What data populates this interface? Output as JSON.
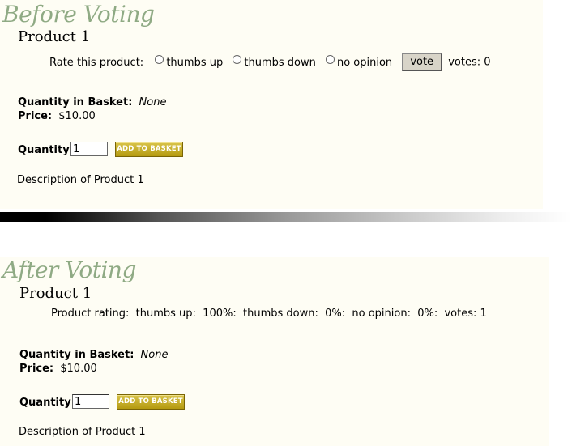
{
  "before": {
    "label": "Before Voting",
    "product_title": "Product 1",
    "rate_label": "Rate this product:",
    "options": [
      "thumbs up",
      "thumbs down",
      "no opinion"
    ],
    "vote_button": "vote",
    "votes_text": "votes: 0",
    "basket_label": "Quantity in Basket:",
    "basket_value": "None",
    "price_label": "Price:",
    "price_value": "$10.00",
    "quantity_label": "Quantity:",
    "quantity_value": "1",
    "add_button": "ADD TO BASKET",
    "description": "Description of Product 1"
  },
  "after": {
    "label": "After Voting",
    "product_title": "Product 1",
    "rating_text": "Product rating:  thumbs up:  100%:  thumbs down:  0%:  no opinion:  0%:  votes: 1",
    "basket_label": "Quantity in Basket:",
    "basket_value": "None",
    "price_label": "Price:",
    "price_value": "$10.00",
    "quantity_label": "Quantity:",
    "quantity_value": "1",
    "add_button": "ADD TO BASKET",
    "description": "Description of Product 1"
  }
}
